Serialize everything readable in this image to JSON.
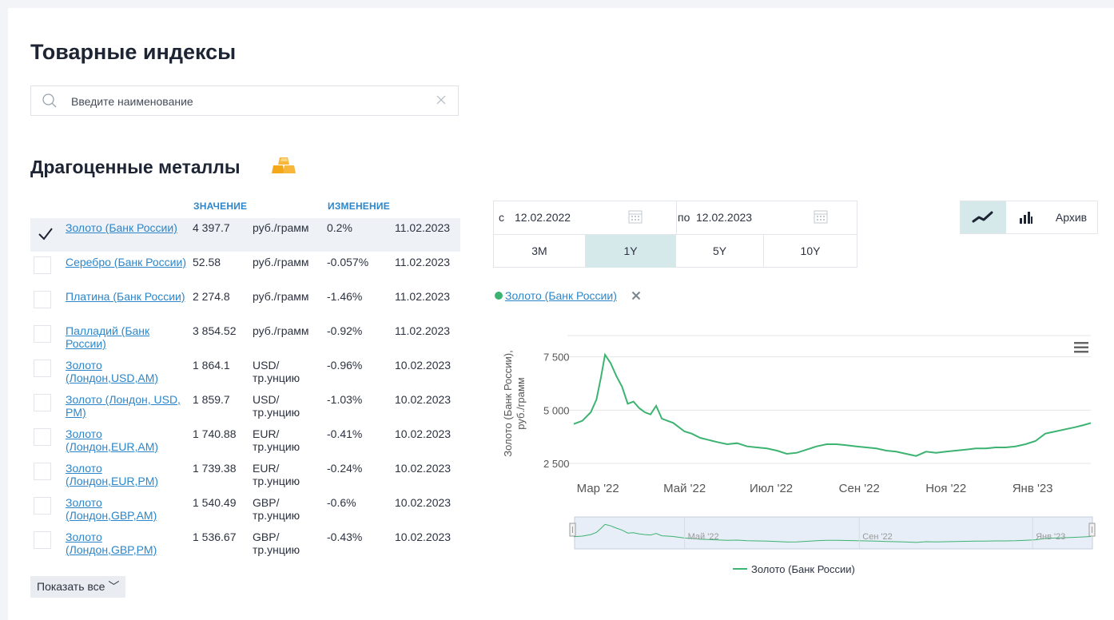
{
  "page": {
    "title": "Товарные индексы"
  },
  "search": {
    "placeholder": "Введите наименование"
  },
  "section": {
    "title": "Драгоценные металлы"
  },
  "table": {
    "headers": {
      "value": "ЗНАЧЕНИЕ",
      "change": "ИЗМЕНЕНИЕ"
    },
    "rows": [
      {
        "name": "Золото (Банк России)",
        "value": "4 397.7",
        "unit": "руб./грамм",
        "change": "0.2%",
        "date": "11.02.2023",
        "selected": true
      },
      {
        "name": "Серебро (Банк России)",
        "value": "52.58",
        "unit": "руб./грамм",
        "change": "-0.057%",
        "date": "11.02.2023",
        "selected": false
      },
      {
        "name": "Платина (Банк России)",
        "value": "2 274.8",
        "unit": "руб./грамм",
        "change": "-1.46%",
        "date": "11.02.2023",
        "selected": false
      },
      {
        "name": "Палладий (Банк России)",
        "value": "3 854.52",
        "unit": "руб./грамм",
        "change": "-0.92%",
        "date": "11.02.2023",
        "selected": false
      },
      {
        "name": "Золото (Лондон,USD,AM)",
        "value": "1 864.1",
        "unit": "USD/ тр.унцию",
        "change": "-0.96%",
        "date": "10.02.2023",
        "selected": false
      },
      {
        "name": "Золото (Лондон, USD, PM)",
        "value": "1 859.7",
        "unit": "USD/ тр.унцию",
        "change": "-1.03%",
        "date": "10.02.2023",
        "selected": false
      },
      {
        "name": "Золото (Лондон,EUR,AM)",
        "value": "1 740.88",
        "unit": "EUR/ тр.унцию",
        "change": "-0.41%",
        "date": "10.02.2023",
        "selected": false
      },
      {
        "name": "Золото (Лондон,EUR,PM)",
        "value": "1 739.38",
        "unit": "EUR/ тр.унцию",
        "change": "-0.24%",
        "date": "10.02.2023",
        "selected": false
      },
      {
        "name": "Золото (Лондон,GBP,AM)",
        "value": "1 540.49",
        "unit": "GBP/ тр.унцию",
        "change": "-0.6%",
        "date": "10.02.2023",
        "selected": false
      },
      {
        "name": "Золото (Лондон,GBP,PM)",
        "value": "1 536.67",
        "unit": "GBP/ тр.унцию",
        "change": "-0.43%",
        "date": "10.02.2023",
        "selected": false
      }
    ]
  },
  "show_all": {
    "label": "Показать все ﹀"
  },
  "period": {
    "from_label": "с",
    "from_value": "12.02.2022",
    "to_label": "по",
    "to_value": "12.02.2023",
    "buttons": [
      "3M",
      "1Y",
      "5Y",
      "10Y"
    ],
    "active": "1Y"
  },
  "view": {
    "archive_label": "Архив",
    "active": "line"
  },
  "selected_series": {
    "label": "Золото (Банк России)",
    "color": "#3cb371"
  },
  "icons": [
    "search-icon",
    "close-icon",
    "gold-bars-icon",
    "checkmark-icon",
    "calendar-icon",
    "line-chart-icon",
    "bar-chart-icon",
    "remove-icon",
    "menu-icon"
  ],
  "chart_data": {
    "type": "line",
    "ylabel": "Золото (Банк России), руб./грамм",
    "y_ticks": [
      "2 500",
      "5 000",
      "7 500"
    ],
    "ylim": [
      2200,
      8500
    ],
    "x_ticks": [
      "Мар '22",
      "Май '22",
      "Июл '22",
      "Сен '22",
      "Ноя '22",
      "Янв '23"
    ],
    "navigator_ticks": [
      "Май '22",
      "Сен '22",
      "Янв '23"
    ],
    "legend": "Золото (Банк России)",
    "series_color": "#3cb371",
    "series": [
      {
        "name": "Золото (Банк России)",
        "x": [
          "2022-02-12",
          "2022-02-18",
          "2022-02-24",
          "2022-02-28",
          "2022-03-03",
          "2022-03-06",
          "2022-03-10",
          "2022-03-14",
          "2022-03-18",
          "2022-03-22",
          "2022-03-26",
          "2022-03-30",
          "2022-04-03",
          "2022-04-07",
          "2022-04-11",
          "2022-04-15",
          "2022-04-19",
          "2022-04-23",
          "2022-04-27",
          "2022-05-01",
          "2022-05-06",
          "2022-05-12",
          "2022-05-18",
          "2022-05-24",
          "2022-05-31",
          "2022-06-07",
          "2022-06-14",
          "2022-06-21",
          "2022-06-28",
          "2022-07-05",
          "2022-07-12",
          "2022-07-19",
          "2022-07-26",
          "2022-08-02",
          "2022-08-09",
          "2022-08-16",
          "2022-08-23",
          "2022-08-30",
          "2022-09-06",
          "2022-09-13",
          "2022-09-20",
          "2022-09-27",
          "2022-10-04",
          "2022-10-11",
          "2022-10-18",
          "2022-10-25",
          "2022-11-01",
          "2022-11-08",
          "2022-11-15",
          "2022-11-22",
          "2022-11-29",
          "2022-12-06",
          "2022-12-13",
          "2022-12-20",
          "2022-12-27",
          "2023-01-03",
          "2023-01-10",
          "2023-01-17",
          "2023-01-24",
          "2023-01-31",
          "2023-02-06",
          "2023-02-11"
        ],
        "values": [
          4350,
          4500,
          4900,
          5500,
          6500,
          7600,
          7200,
          6600,
          6100,
          5300,
          5400,
          5100,
          4900,
          4800,
          5200,
          4600,
          4500,
          4400,
          4200,
          4000,
          3900,
          3700,
          3600,
          3500,
          3400,
          3450,
          3300,
          3250,
          3200,
          3100,
          2950,
          3000,
          3150,
          3300,
          3400,
          3400,
          3350,
          3300,
          3250,
          3200,
          3100,
          3050,
          2950,
          2850,
          3050,
          3000,
          3050,
          3100,
          3150,
          3200,
          3200,
          3250,
          3250,
          3300,
          3400,
          3550,
          3900,
          4000,
          4100,
          4200,
          4300,
          4397.7
        ]
      }
    ]
  }
}
